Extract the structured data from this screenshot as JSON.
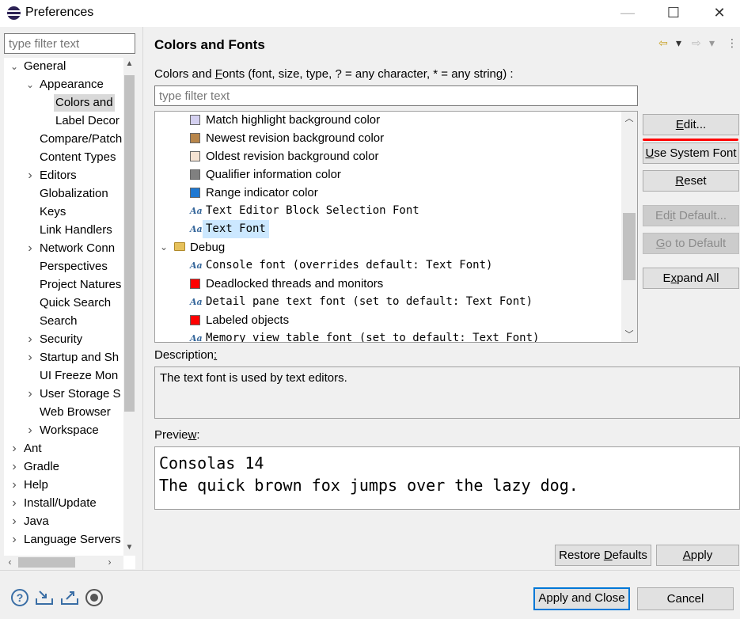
{
  "window": {
    "title": "Preferences",
    "minimize_glyph": "—",
    "maximize_glyph": "☐",
    "close_glyph": "✕"
  },
  "left": {
    "filter_placeholder": "type filter text",
    "tree": [
      {
        "label": "General",
        "depth": 0,
        "expander": "open"
      },
      {
        "label": "Appearance",
        "depth": 1,
        "expander": "open"
      },
      {
        "label": "Colors and",
        "depth": 2,
        "expander": "none",
        "selected": true
      },
      {
        "label": "Label Decor",
        "depth": 2,
        "expander": "none"
      },
      {
        "label": "Compare/Patch",
        "depth": 1,
        "expander": "none"
      },
      {
        "label": "Content Types",
        "depth": 1,
        "expander": "none"
      },
      {
        "label": "Editors",
        "depth": 1,
        "expander": "closed"
      },
      {
        "label": "Globalization",
        "depth": 1,
        "expander": "none"
      },
      {
        "label": "Keys",
        "depth": 1,
        "expander": "none"
      },
      {
        "label": "Link Handlers",
        "depth": 1,
        "expander": "none"
      },
      {
        "label": "Network Conn",
        "depth": 1,
        "expander": "closed"
      },
      {
        "label": "Perspectives",
        "depth": 1,
        "expander": "none"
      },
      {
        "label": "Project Natures",
        "depth": 1,
        "expander": "none"
      },
      {
        "label": "Quick Search",
        "depth": 1,
        "expander": "none"
      },
      {
        "label": "Search",
        "depth": 1,
        "expander": "none"
      },
      {
        "label": "Security",
        "depth": 1,
        "expander": "closed"
      },
      {
        "label": "Startup and Sh",
        "depth": 1,
        "expander": "closed"
      },
      {
        "label": "UI Freeze Mon",
        "depth": 1,
        "expander": "none"
      },
      {
        "label": "User Storage S",
        "depth": 1,
        "expander": "closed"
      },
      {
        "label": "Web Browser",
        "depth": 1,
        "expander": "none"
      },
      {
        "label": "Workspace",
        "depth": 1,
        "expander": "closed"
      },
      {
        "label": "Ant",
        "depth": 0,
        "expander": "closed"
      },
      {
        "label": "Gradle",
        "depth": 0,
        "expander": "closed"
      },
      {
        "label": "Help",
        "depth": 0,
        "expander": "closed"
      },
      {
        "label": "Install/Update",
        "depth": 0,
        "expander": "closed"
      },
      {
        "label": "Java",
        "depth": 0,
        "expander": "closed"
      },
      {
        "label": "Language Servers",
        "depth": 0,
        "expander": "closed"
      }
    ]
  },
  "page": {
    "title": "Colors and Fonts",
    "caption_pre": "Colors and ",
    "caption_mnemonic": "F",
    "caption_post": "onts (font, size, type, ? = any character, * = any string) :",
    "filter_placeholder": "type filter text",
    "nav": {
      "back_glyph": "⇦",
      "dropdown_glyph": "▾",
      "forward_glyph": "⇨",
      "menu_glyph": "⋮"
    },
    "items": [
      {
        "kind": "color",
        "label": "Match highlight background color",
        "color": "#d4d0f0"
      },
      {
        "kind": "color",
        "label": "Newest revision background color",
        "color": "#b8864b"
      },
      {
        "kind": "color",
        "label": "Oldest revision background color",
        "color": "#f5e3d3"
      },
      {
        "kind": "color",
        "label": "Qualifier information color",
        "color": "#808080"
      },
      {
        "kind": "color",
        "label": "Range indicator color",
        "color": "#1e78d2"
      },
      {
        "kind": "font",
        "label": "Text Editor Block Selection Font"
      },
      {
        "kind": "font",
        "label": "Text Font",
        "selected": true
      },
      {
        "kind": "category",
        "label": "Debug"
      },
      {
        "kind": "font",
        "label": "Console font (overrides default: Text Font)"
      },
      {
        "kind": "color",
        "label": "Deadlocked threads and monitors",
        "color": "#ff0000"
      },
      {
        "kind": "font",
        "label": "Detail pane text font (set to default: Text Font)"
      },
      {
        "kind": "color",
        "label": "Labeled objects",
        "color": "#ff0000"
      },
      {
        "kind": "font",
        "label": "Memory view table font (set to default: Text Font)"
      }
    ],
    "font_icon_glyph": "Aa",
    "buttons": {
      "edit": {
        "pre": "",
        "mn": "E",
        "post": "dit..."
      },
      "use_system_font": {
        "pre": "",
        "mn": "U",
        "post": "se System Font"
      },
      "reset": {
        "pre": "",
        "mn": "R",
        "post": "eset"
      },
      "edit_default": {
        "pre": "Ed",
        "mn": "i",
        "post": "t Default..."
      },
      "go_to_default": {
        "pre": "",
        "mn": "G",
        "post": "o to Default"
      },
      "expand_all": {
        "pre": "E",
        "mn": "x",
        "post": "pand All"
      }
    },
    "description_label_pre": "Description",
    "description_label_mn": ":",
    "description": "The text font is used by text editors.",
    "preview_label_pre": "Previe",
    "preview_label_mn": "w",
    "preview_label_post": ":",
    "preview_line1": "Consolas 14",
    "preview_line2": "The quick brown fox jumps over the lazy dog.",
    "restore_defaults": {
      "pre": "Restore ",
      "mn": "D",
      "post": "efaults"
    },
    "apply": {
      "pre": "",
      "mn": "A",
      "post": "pply"
    }
  },
  "footer": {
    "help_glyph": "?",
    "apply_and_close": "Apply and Close",
    "cancel": "Cancel"
  }
}
